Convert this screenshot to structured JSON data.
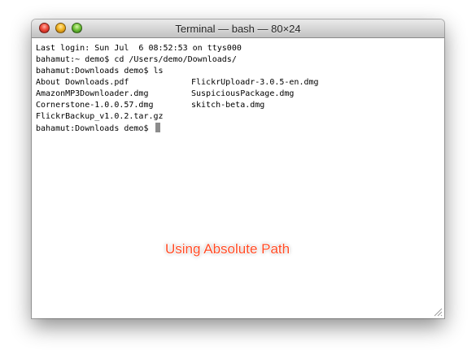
{
  "window": {
    "title": "Terminal — bash — 80×24"
  },
  "terminal": {
    "lines": [
      "Last login: Sun Jul  6 08:52:53 on ttys000",
      "bahamut:~ demo$ cd /Users/demo/Downloads/",
      "bahamut:Downloads demo$ ls"
    ],
    "listing": [
      [
        "About Downloads.pdf",
        "FlickrUploadr-3.0.5-en.dmg"
      ],
      [
        "AmazonMP3Downloader.dmg",
        "SuspiciousPackage.dmg"
      ],
      [
        "Cornerstone-1.0.0.57.dmg",
        "skitch-beta.dmg"
      ],
      [
        "FlickrBackup_v1.0.2.tar.gz",
        ""
      ]
    ],
    "prompt": "bahamut:Downloads demo$ "
  },
  "annotation": "Using Absolute Path",
  "colors": {
    "annotation": "#ff4a24",
    "cursor": "#8c8c8c",
    "close": "#ee4a3b",
    "minimize": "#f2b524",
    "zoom": "#72c43a"
  },
  "icons": [
    "close-button-icon",
    "minimize-button-icon",
    "zoom-button-icon",
    "resize-grip-icon"
  ]
}
